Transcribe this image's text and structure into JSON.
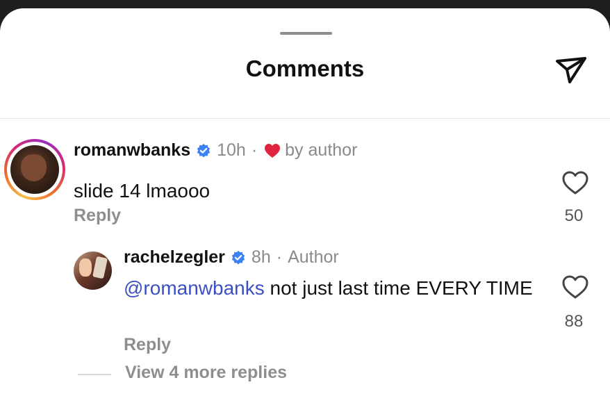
{
  "header": {
    "title": "Comments",
    "share_icon": "paper-plane-icon"
  },
  "comments": [
    {
      "username": "romanwbanks",
      "verified": true,
      "time": "10h",
      "separator": "·",
      "badge": "by author",
      "badge_icon": "heart-icon",
      "badge_color": "#e0243d",
      "text": "slide 14 lmaooo",
      "reply_label": "Reply",
      "likes": "50",
      "replies": [
        {
          "username": "rachelzegler",
          "verified": true,
          "time": "8h",
          "separator": "·",
          "badge": "Author",
          "mention": "@romanwbanks",
          "text": " not just last time EVERY TIME",
          "reply_label": "Reply",
          "likes": "88"
        }
      ],
      "view_more_label": "View 4 more replies"
    }
  ],
  "colors": {
    "verified": "#3b82f6",
    "mention": "#3b4fc4",
    "secondary_text": "#8e8e8e"
  }
}
